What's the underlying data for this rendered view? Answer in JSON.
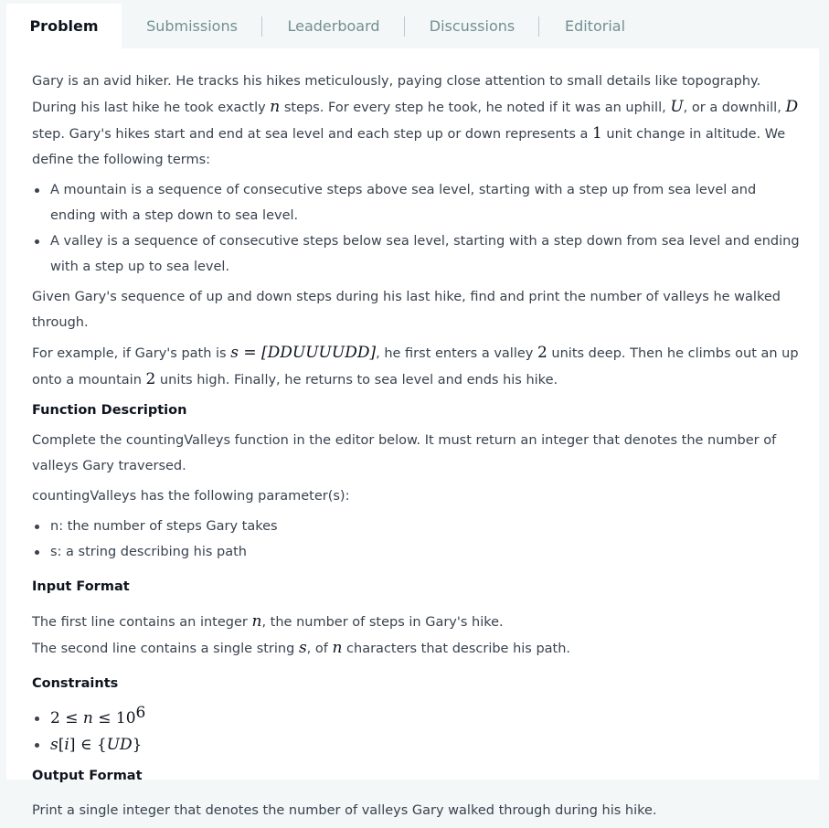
{
  "tabs": [
    {
      "label": "Problem"
    },
    {
      "label": "Submissions"
    },
    {
      "label": "Leaderboard"
    },
    {
      "label": "Discussions"
    },
    {
      "label": "Editorial"
    }
  ],
  "problem": {
    "intro": {
      "t1": "Gary is an avid hiker. He tracks his hikes meticulously, paying close attention to small details like topography. During his last hike he took exactly ",
      "v_n": "n",
      "t2": " steps. For every step he took, he noted if it was an uphill, ",
      "v_U": "U",
      "t3": ", or a downhill, ",
      "v_D": "D",
      "t4": " step. Gary's hikes start and end at sea level and each step up or down represents a ",
      "v_1": "1",
      "t5": " unit change in altitude. We define the following terms:"
    },
    "definitions": [
      "A mountain is a sequence of consecutive steps above sea level, starting with a step up from sea level and ending with a step down to sea level.",
      "A valley is a sequence of consecutive steps below sea level, starting with a step down from sea level and ending with a step up to sea level."
    ],
    "task": "Given Gary's sequence of up and down steps during his last hike, find and print the number of valleys he walked through.",
    "example": {
      "t1": "For example, if Gary's path is ",
      "math_s": "s",
      "math_eq": " = ",
      "math_path": "[DDUUUUDD]",
      "t2": ", he first enters a valley ",
      "v_2a": "2",
      "t3": " units deep. Then he climbs out an up onto a mountain ",
      "v_2b": "2",
      "t4": " units high. Finally, he returns to sea level and ends his hike."
    },
    "function_heading": "Function Description",
    "function_desc": "Complete the countingValleys function in the editor below. It must return an integer that denotes the number of valleys Gary traversed.",
    "params_intro": "countingValleys has the following parameter(s):",
    "params": [
      "n: the number of steps Gary takes",
      "s: a string describing his path"
    ],
    "input_heading": "Input Format",
    "input_line1": {
      "t1": "The first line contains an integer ",
      "v_n": "n",
      "t2": ", the number of steps in Gary's hike."
    },
    "input_line2": {
      "t1": "The second line contains a single string ",
      "v_s": "s",
      "t2": ", of ",
      "v_n": "n",
      "t3": " characters that describe his path."
    },
    "constraints_heading": "Constraints",
    "constraint1": {
      "a": "2 ≤ ",
      "n": "n",
      "b": " ≤ 10",
      "exp": "6"
    },
    "constraint2": {
      "s": "s",
      "i_open": "[",
      "i": "i",
      "i_close": "] ∈ {",
      "set": "UD",
      "end": "}"
    },
    "output_heading": "Output Format",
    "output_desc": "Print a single integer that denotes the number of valleys Gary walked through during his hike."
  }
}
